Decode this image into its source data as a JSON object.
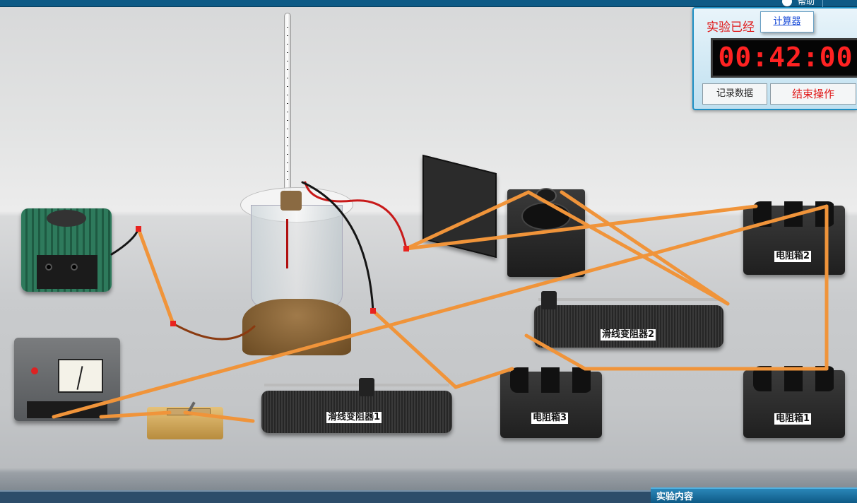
{
  "header": {
    "title": "",
    "help": "帮助"
  },
  "timer": {
    "status_text": "实验已经",
    "calculator_label": "计算器",
    "elapsed": "00:42:00",
    "record_data_label": "记录数据",
    "end_operation_label": "结束操作"
  },
  "equipment": {
    "rheostat1": "滑线变阻器1",
    "rheostat2": "滑线变阻器2",
    "resistance_box1": "电阻箱1",
    "resistance_box2": "电阻箱2",
    "resistance_box3": "电阻箱3"
  },
  "bottom_panel": {
    "title": "实验内容"
  },
  "colors": {
    "wire": "#f0943a",
    "accent": "#0e5a86",
    "alert": "#e01515"
  }
}
